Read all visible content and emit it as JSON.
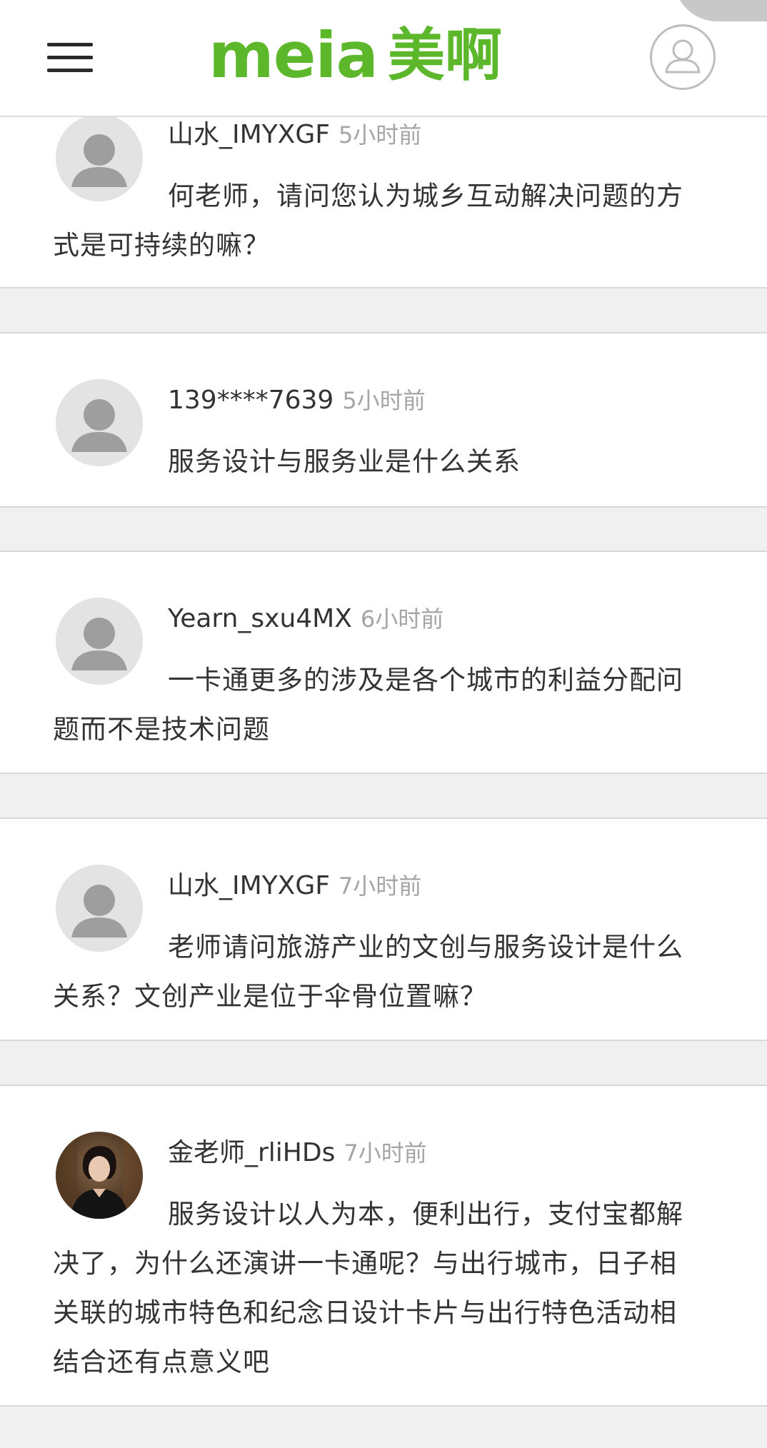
{
  "header": {
    "menu_icon": "hamburger-menu-icon",
    "logo_latin": "meia",
    "logo_cjk": "美啊",
    "user_icon": "user-profile-icon",
    "brand_color": "#5cb82a"
  },
  "comments": [
    {
      "username": "山水_IMYXGF",
      "time": "5小时前",
      "content": "何老师，请问您认为城乡互动解决问题的方式是可持续的嘛？",
      "avatar": "default-avatar-icon"
    },
    {
      "username": "139****7639",
      "time": "5小时前",
      "content": "服务设计与服务业是什么关系",
      "avatar": "default-avatar-icon"
    },
    {
      "username": "Yearn_sxu4MX",
      "time": "6小时前",
      "content": "一卡通更多的涉及是各个城市的利益分配问题而不是技术问题",
      "avatar": "default-avatar-icon"
    },
    {
      "username": "山水_IMYXGF",
      "time": "7小时前",
      "content": "老师请问旅游产业的文创与服务设计是什么关系？文创产业是位于伞骨位置嘛？",
      "avatar": "default-avatar-icon"
    },
    {
      "username": "金老师_rliHDs",
      "time": "7小时前",
      "content": "服务设计以人为本，便利出行，支付宝都解决了，为什么还演讲一卡通呢？与出行城市，日子相关联的城市特色和纪念日设计卡片与出行特色活动相结合还有点意义吧",
      "avatar": "user-photo-avatar"
    }
  ]
}
